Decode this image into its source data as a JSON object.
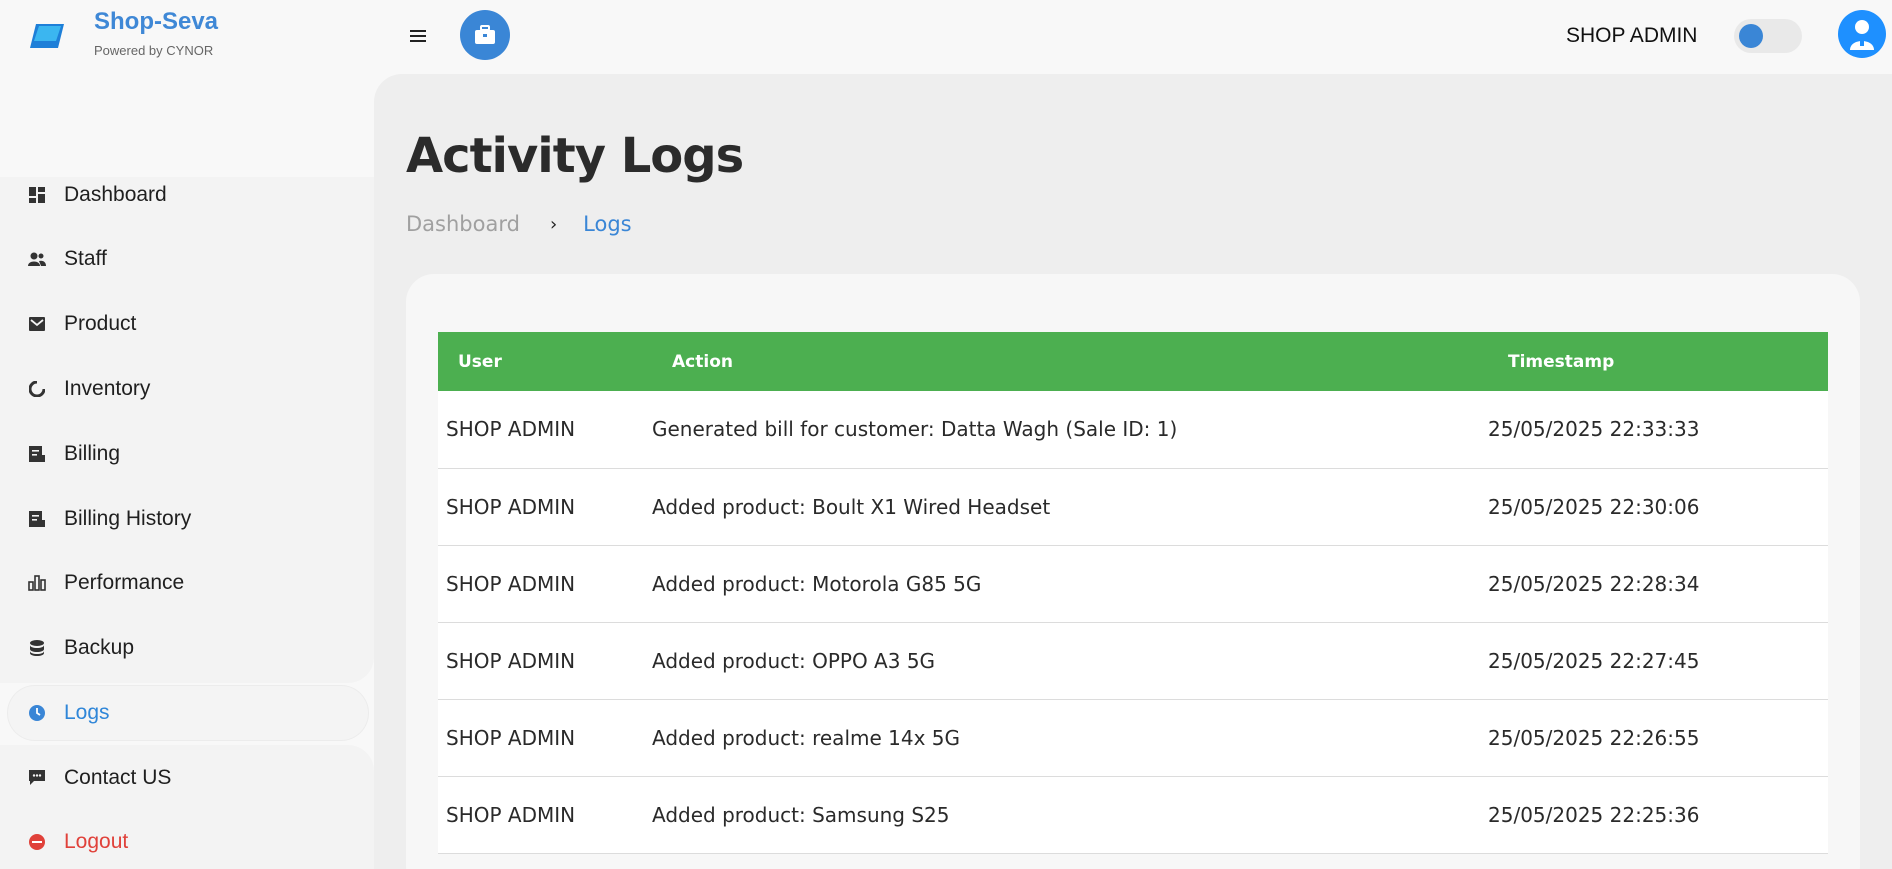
{
  "brand": {
    "name": "Shop-Seva",
    "subtitle": "Powered by CYNOR",
    "accent_color": "#3f88d6"
  },
  "header": {
    "user_label": "SHOP ADMIN",
    "menu_icon": "hamburger-icon",
    "briefcase_icon": "briefcase-icon",
    "avatar_icon": "user-avatar-icon",
    "theme_toggle_on": false
  },
  "sidebar": {
    "items": [
      {
        "label": "Dashboard",
        "icon": "dashboard-icon"
      },
      {
        "label": "Staff",
        "icon": "staff-icon"
      },
      {
        "label": "Product",
        "icon": "product-icon"
      },
      {
        "label": "Inventory",
        "icon": "inventory-icon"
      },
      {
        "label": "Billing",
        "icon": "billing-icon"
      },
      {
        "label": "Billing History",
        "icon": "billing-history-icon"
      },
      {
        "label": "Performance",
        "icon": "performance-icon"
      },
      {
        "label": "Backup",
        "icon": "backup-icon"
      },
      {
        "label": "Logs",
        "icon": "clock-icon",
        "active": true
      },
      {
        "label": "Contact US",
        "icon": "chat-icon"
      },
      {
        "label": "Logout",
        "icon": "logout-icon"
      }
    ]
  },
  "page": {
    "title": "Activity Logs",
    "breadcrumb": {
      "home": "Dashboard",
      "current": "Logs"
    }
  },
  "table": {
    "header_color": "#4caf50",
    "columns": {
      "user": "User",
      "action": "Action",
      "timestamp": "Timestamp"
    },
    "rows": [
      {
        "user": "SHOP ADMIN",
        "action": "Generated bill for customer: Datta Wagh (Sale ID: 1)",
        "timestamp": "25/05/2025 22:33:33"
      },
      {
        "user": "SHOP ADMIN",
        "action": "Added product: Boult X1 Wired Headset",
        "timestamp": "25/05/2025 22:30:06"
      },
      {
        "user": "SHOP ADMIN",
        "action": "Added product: Motorola G85 5G",
        "timestamp": "25/05/2025 22:28:34"
      },
      {
        "user": "SHOP ADMIN",
        "action": "Added product: OPPO A3 5G",
        "timestamp": "25/05/2025 22:27:45"
      },
      {
        "user": "SHOP ADMIN",
        "action": "Added product: realme 14x 5G",
        "timestamp": "25/05/2025 22:26:55"
      },
      {
        "user": "SHOP ADMIN",
        "action": "Added product: Samsung S25",
        "timestamp": "25/05/2025 22:25:36"
      }
    ]
  }
}
